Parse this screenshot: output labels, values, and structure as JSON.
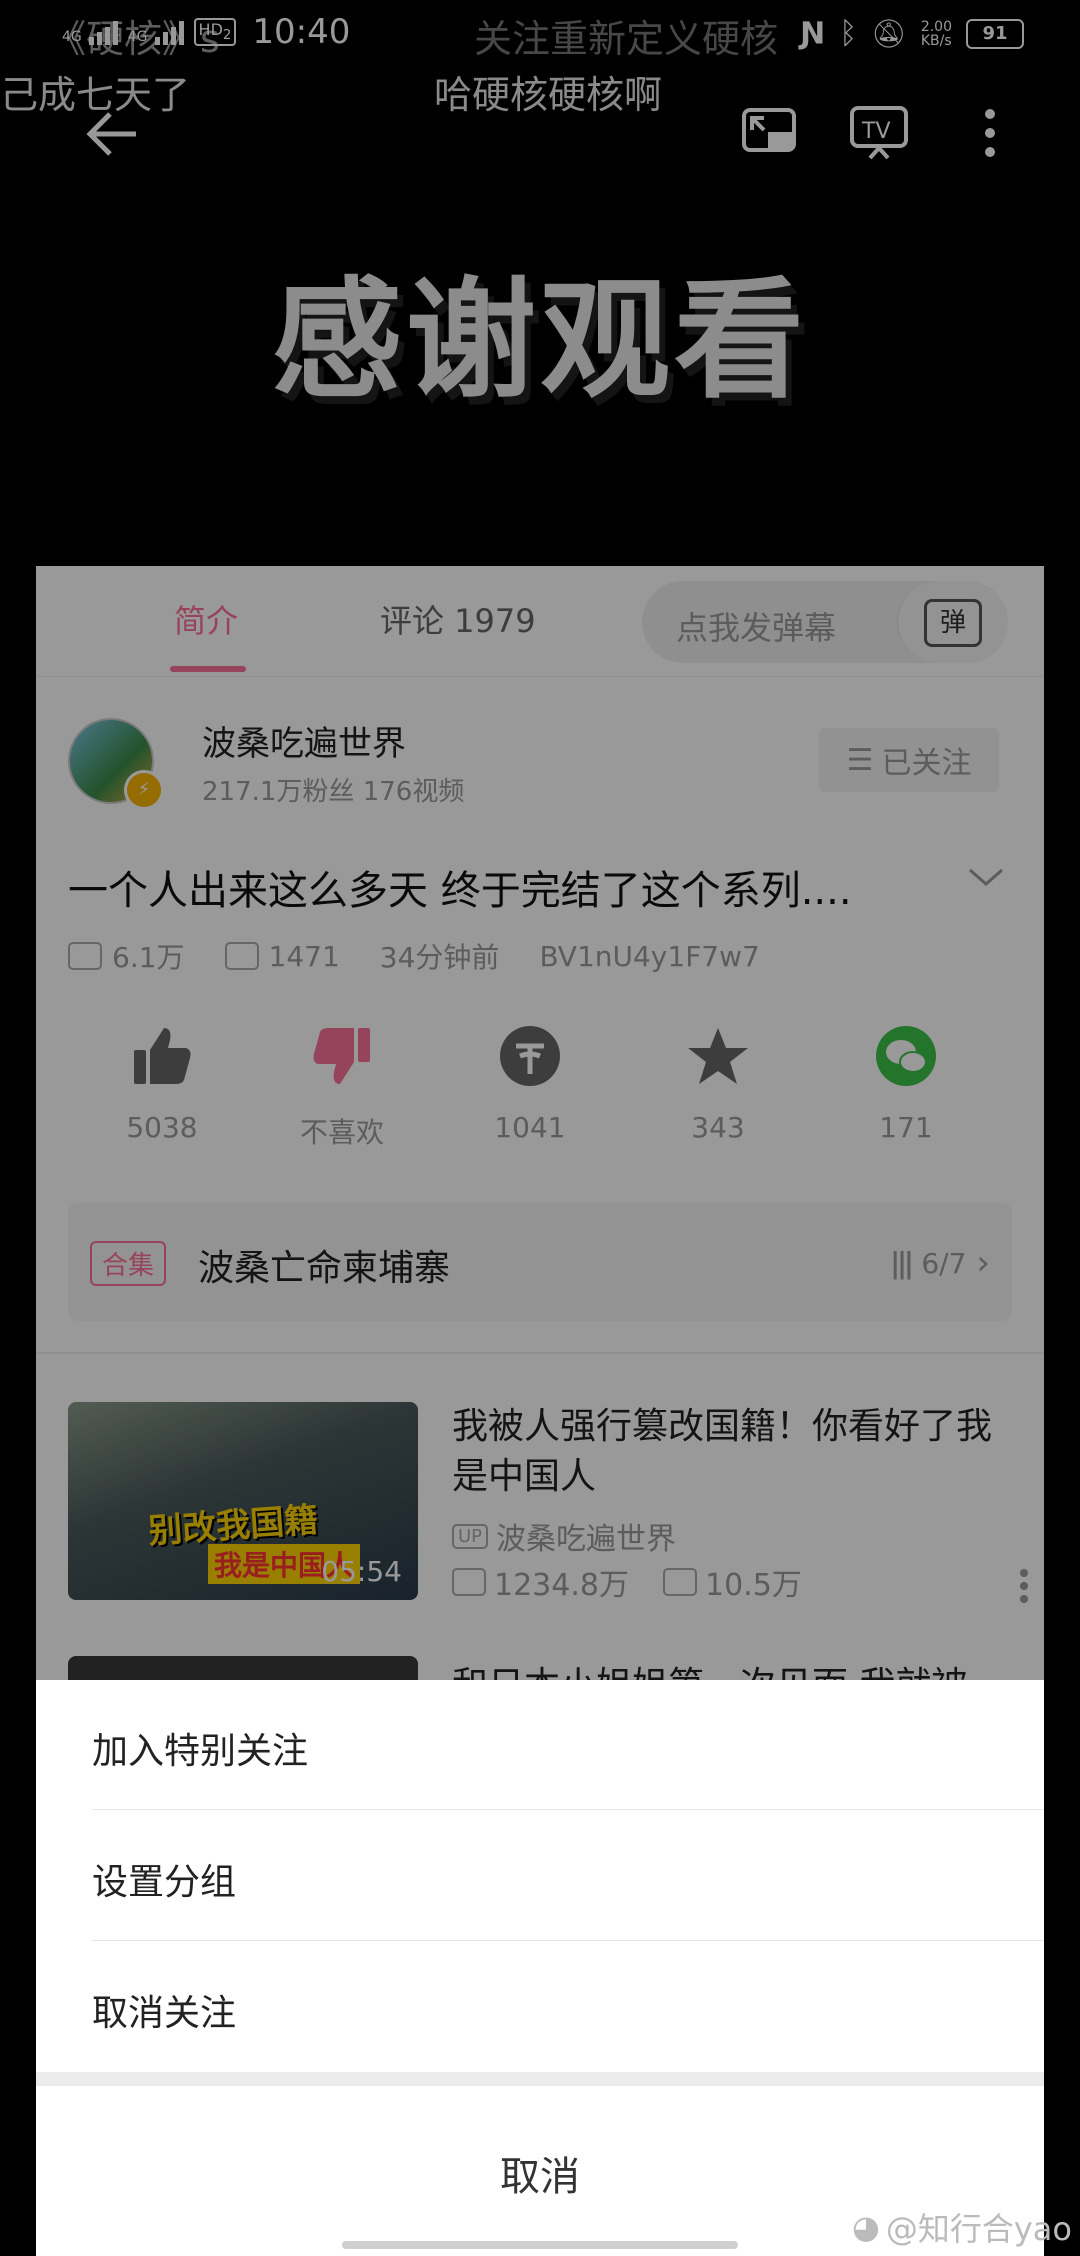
{
  "status_bar": {
    "net1": "4G",
    "net2": "4G",
    "hd": "HD",
    "hd_sub": "2",
    "time": "10:40",
    "speed_value": "2.00",
    "speed_unit": "KB/s",
    "battery": "91"
  },
  "video": {
    "overlay_title": "感谢观看",
    "danmaku_line1_left": "《硬核》s",
    "danmaku_line1_right": "关注重新定义硬核",
    "danmaku_line2_left": "己成七天了",
    "danmaku_line2_right": "哈硬核硬核啊"
  },
  "tabs": {
    "intro": "简介",
    "comments": "评论 1979",
    "danmaku_placeholder": "点我发弹幕",
    "danmaku_btn": "弹"
  },
  "uploader": {
    "name": "波桑吃遍世界",
    "meta": "217.1万粉丝   176视频",
    "follow_state": "已关注"
  },
  "video_info": {
    "title": "一个人出来这么多天 终于完结了这个系列....",
    "plays": "6.1万",
    "danmaku_count": "1471",
    "time_ago": "34分钟前",
    "bvid": "BV1nU4y1F7w7"
  },
  "actions": [
    {
      "label": "5038",
      "icon": "like-icon"
    },
    {
      "label": "不喜欢",
      "icon": "dislike-icon"
    },
    {
      "label": "1041",
      "icon": "coin-icon"
    },
    {
      "label": "343",
      "icon": "star-icon"
    },
    {
      "label": "171",
      "icon": "wechat-icon"
    }
  ],
  "season": {
    "tag": "合集",
    "name": "波桑亡命柬埔寨",
    "progress": "6/7"
  },
  "recommendation": {
    "thumb_caption1": "别改我国籍",
    "thumb_caption2": "我是中国人",
    "duration": "05:54",
    "title": "我被人强行篡改国籍！你看好了我是中国人",
    "up_badge": "UP",
    "uploader": "波桑吃遍世界",
    "plays": "1234.8万",
    "danmaku": "10.5万"
  },
  "recommendation2": {
    "title": "和日本小姐姐第一次见面 我就被"
  },
  "sheet": {
    "item1": "加入特别关注",
    "item2": "设置分组",
    "item3": "取消关注",
    "cancel": "取消"
  },
  "watermark": "@知行合yao",
  "colors": {
    "accent": "#fb7299",
    "wechat": "#3ec24a"
  }
}
